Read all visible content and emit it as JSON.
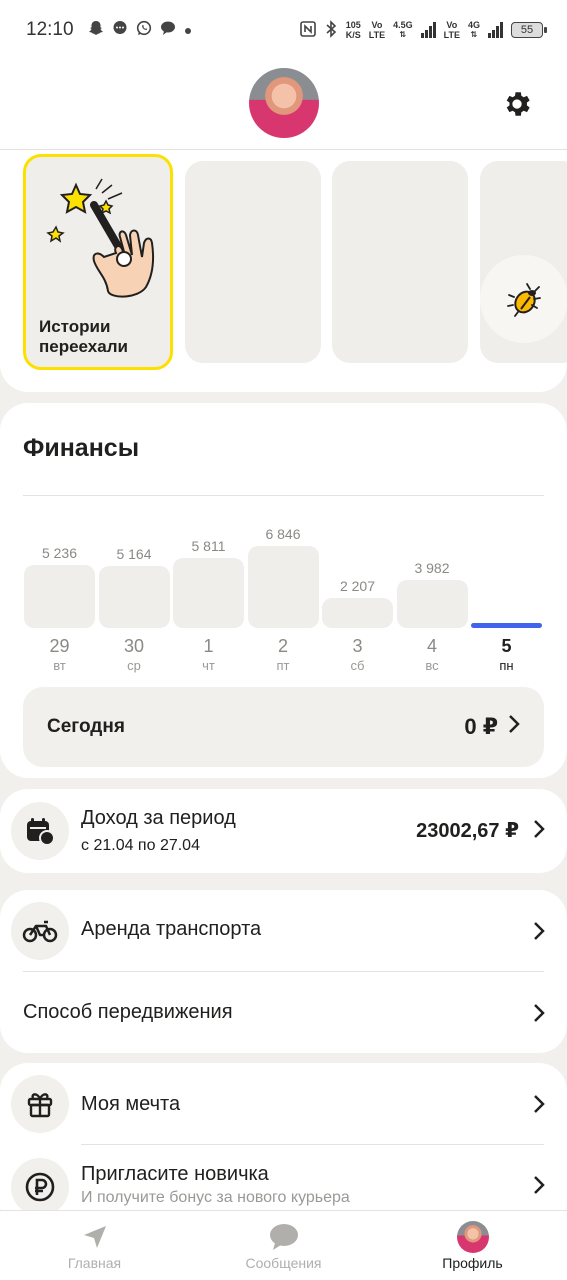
{
  "status_bar": {
    "time": "12:10",
    "notification_icons": [
      "snapchat-icon",
      "messenger-icon",
      "whatsapp-icon",
      "chat-icon",
      "dot-icon"
    ],
    "net_speed_top": "105",
    "net_speed_bottom": "K/S",
    "volte1_top": "Vo",
    "volte1_bottom": "LTE",
    "net_type1": "4.5G",
    "volte2_top": "Vo",
    "volte2_bottom": "LTE",
    "net_type2": "4G",
    "battery": "55"
  },
  "header": {
    "avatar": "user-avatar",
    "settings_icon": "gear-icon"
  },
  "stories": {
    "main_title": "Истории переехали",
    "main_icon": "magic-wand-hand-icon",
    "bug_icon": "bug-icon"
  },
  "finance": {
    "title": "Финансы",
    "accent_color": "#4263eb",
    "today_label": "Сегодня",
    "today_amount": "0 ₽"
  },
  "chart_data": {
    "type": "bar",
    "categories": [
      "29",
      "30",
      "1",
      "2",
      "3",
      "4",
      "5"
    ],
    "weekdays": [
      "вт",
      "ср",
      "чт",
      "пт",
      "сб",
      "вс",
      "пн"
    ],
    "values": [
      5236,
      5164,
      5811,
      6846,
      2207,
      3982,
      0
    ],
    "value_labels": [
      "5 236",
      "5 164",
      "5 811",
      "6 846",
      "2 207",
      "3 982",
      ""
    ],
    "active_index": 6
  },
  "income": {
    "title": "Доход за период",
    "period": "с 21.04 по 27.04",
    "amount": "23002,67 ₽",
    "icon": "calendar-money-icon"
  },
  "transport": {
    "rent_label": "Аренда транспорта",
    "rent_icon": "bicycle-icon",
    "movement_label": "Способ передвижения"
  },
  "extras": {
    "dream_label": "Моя мечта",
    "dream_icon": "gift-icon",
    "invite_label": "Пригласите новичка",
    "invite_sub": "И получите бонус за нового курьера",
    "invite_icon": "ruble-icon"
  },
  "tabbar": {
    "tabs": [
      {
        "label": "Главная",
        "icon": "navigation-arrow-icon"
      },
      {
        "label": "Сообщения",
        "icon": "chat-bubble-icon"
      },
      {
        "label": "Профиль",
        "icon": "profile-avatar"
      }
    ]
  }
}
